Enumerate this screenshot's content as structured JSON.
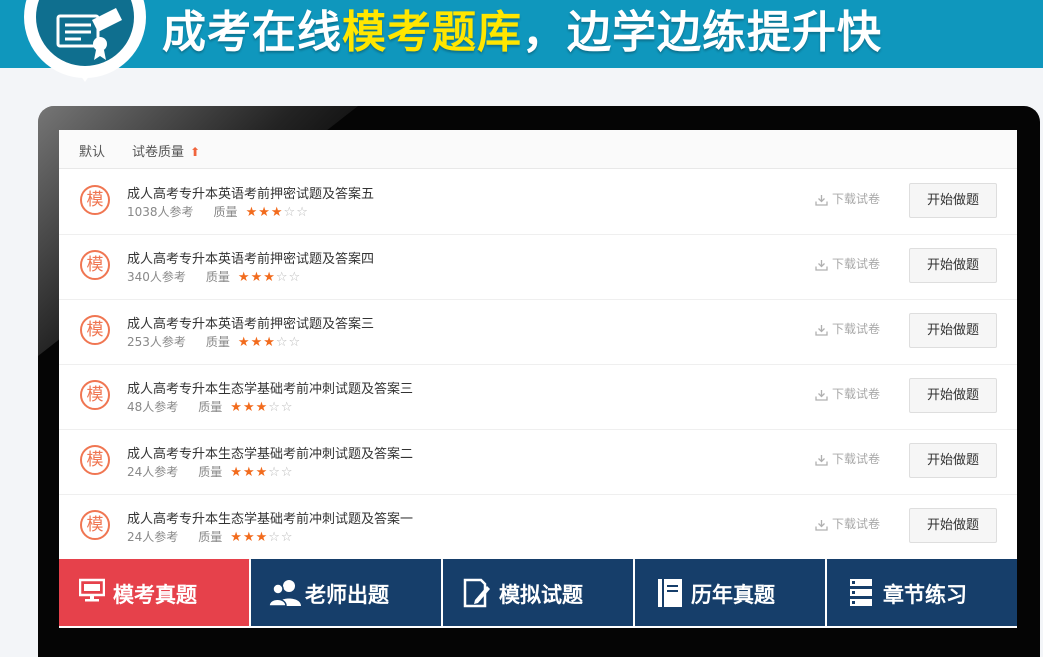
{
  "banner": {
    "title_white": "成考在线",
    "title_highlight": "模考题库",
    "title_rest": "，边学边练提升快",
    "icon": "certificate-icon"
  },
  "sortbar": {
    "default_label": "默认",
    "quality_label": "试卷质量",
    "quality_arrow": "⬆"
  },
  "list": {
    "badge_text": "模",
    "quality_prefix": "质量",
    "download_label": "下载试卷",
    "start_label": "开始做题",
    "items": [
      {
        "title": "成人高考专升本英语考前押密试题及答案五",
        "participants": "1038人参考",
        "stars": 3
      },
      {
        "title": "成人高考专升本英语考前押密试题及答案四",
        "participants": "340人参考",
        "stars": 3
      },
      {
        "title": "成人高考专升本英语考前押密试题及答案三",
        "participants": "253人参考",
        "stars": 3
      },
      {
        "title": "成人高考专升本生态学基础考前冲刺试题及答案三",
        "participants": "48人参考",
        "stars": 3
      },
      {
        "title": "成人高考专升本生态学基础考前冲刺试题及答案二",
        "participants": "24人参考",
        "stars": 3
      },
      {
        "title": "成人高考专升本生态学基础考前冲刺试题及答案一",
        "participants": "24人参考",
        "stars": 3
      }
    ]
  },
  "tabs": [
    {
      "label": "模考真题",
      "icon": "monitor-icon",
      "active": true
    },
    {
      "label": "老师出题",
      "icon": "users-icon",
      "active": false
    },
    {
      "label": "模拟试题",
      "icon": "document-edit-icon",
      "active": false
    },
    {
      "label": "历年真题",
      "icon": "book-icon",
      "active": false
    },
    {
      "label": "章节练习",
      "icon": "list-icon",
      "active": false
    }
  ],
  "colors": {
    "banner": "#0f97bd",
    "highlight": "#ffe600",
    "star": "#f26b1d",
    "tab_active": "#e6414b",
    "tab_default": "#163e6a"
  }
}
